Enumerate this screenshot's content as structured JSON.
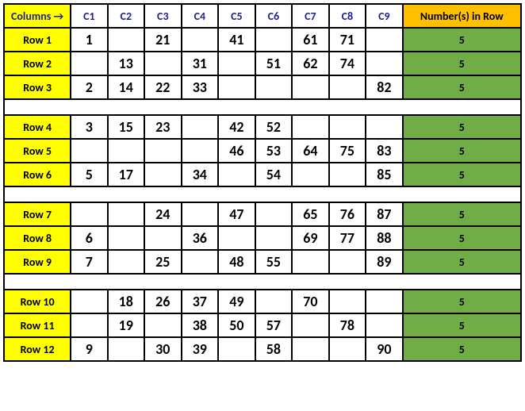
{
  "chart_data": {
    "type": "table",
    "corner_label": "Columns →",
    "count_header": "Number(s) in Row",
    "columns": [
      "C1",
      "C2",
      "C3",
      "C4",
      "C5",
      "C6",
      "C7",
      "C8",
      "C9"
    ],
    "groups": [
      {
        "rows": [
          {
            "label": "Row 1",
            "cells": [
              "1",
              "",
              "21",
              "",
              "41",
              "",
              "61",
              "71",
              ""
            ],
            "count": "5"
          },
          {
            "label": "Row 2",
            "cells": [
              "",
              "13",
              "",
              "31",
              "",
              "51",
              "62",
              "74",
              ""
            ],
            "count": "5"
          },
          {
            "label": "Row 3",
            "cells": [
              "2",
              "14",
              "22",
              "33",
              "",
              "",
              "",
              "",
              "82"
            ],
            "count": "5"
          }
        ]
      },
      {
        "rows": [
          {
            "label": "Row 4",
            "cells": [
              "3",
              "15",
              "23",
              "",
              "42",
              "52",
              "",
              "",
              ""
            ],
            "count": "5"
          },
          {
            "label": "Row 5",
            "cells": [
              "",
              "",
              "",
              "",
              "46",
              "53",
              "64",
              "75",
              "83"
            ],
            "count": "5"
          },
          {
            "label": "Row 6",
            "cells": [
              "5",
              "17",
              "",
              "34",
              "",
              "54",
              "",
              "",
              "85"
            ],
            "count": "5"
          }
        ]
      },
      {
        "rows": [
          {
            "label": "Row 7",
            "cells": [
              "",
              "",
              "24",
              "",
              "47",
              "",
              "65",
              "76",
              "87"
            ],
            "count": "5"
          },
          {
            "label": "Row 8",
            "cells": [
              "6",
              "",
              "",
              "36",
              "",
              "",
              "69",
              "77",
              "88"
            ],
            "count": "5"
          },
          {
            "label": "Row 9",
            "cells": [
              "7",
              "",
              "25",
              "",
              "48",
              "55",
              "",
              "",
              "89"
            ],
            "count": "5"
          }
        ]
      },
      {
        "rows": [
          {
            "label": "Row 10",
            "cells": [
              "",
              "18",
              "26",
              "37",
              "49",
              "",
              "70",
              "",
              ""
            ],
            "count": "5"
          },
          {
            "label": "Row 11",
            "cells": [
              "",
              "19",
              "",
              "38",
              "50",
              "57",
              "",
              "78",
              ""
            ],
            "count": "5"
          },
          {
            "label": "Row 12",
            "cells": [
              "9",
              "",
              "30",
              "39",
              "",
              "58",
              "",
              "",
              "90"
            ],
            "count": "5"
          }
        ]
      }
    ]
  }
}
